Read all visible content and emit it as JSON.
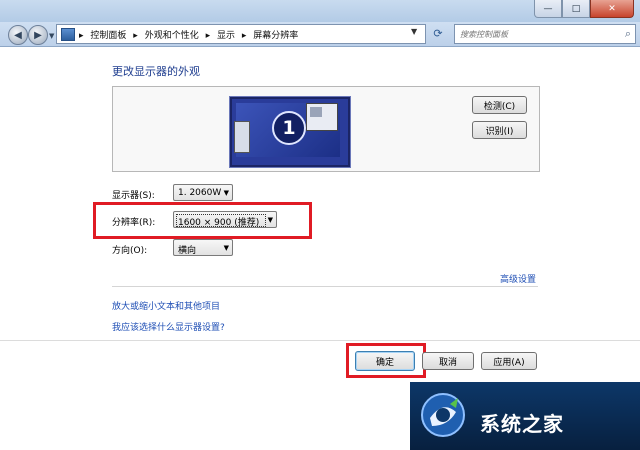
{
  "window": {
    "minimize_glyph": "—",
    "maximize_glyph": "□",
    "close_glyph": "✕"
  },
  "nav": {
    "back_glyph": "◀",
    "forward_glyph": "▶",
    "breadcrumbs": [
      "▸",
      "控制面板",
      "▸",
      "外观和个性化",
      "▸",
      "显示",
      "▸",
      "屏幕分辨率"
    ],
    "search_placeholder": "搜索控制面板"
  },
  "content": {
    "heading": "更改显示器的外观",
    "monitor_number": "1",
    "detect_label": "检测(C)",
    "identify_label": "识别(I)",
    "display_label": "显示器(S):",
    "display_value": "1. 2060W",
    "resolution_label": "分辨率(R):",
    "resolution_value": "1600 × 900 (推荐)",
    "orientation_label": "方向(O):",
    "orientation_value": "横向",
    "advanced_link": "高级设置",
    "enlarge_link": "放大或缩小文本和其他项目",
    "which_link": "我应该选择什么显示器设置?"
  },
  "footer": {
    "ok_label": "确定",
    "cancel_label": "取消",
    "apply_label": "应用(A)"
  },
  "watermark": {
    "text": "系统之家"
  },
  "colors": {
    "highlight_red": "#e01b24",
    "link_blue": "#1f4fb5",
    "heading_blue": "#1e3d8f"
  }
}
